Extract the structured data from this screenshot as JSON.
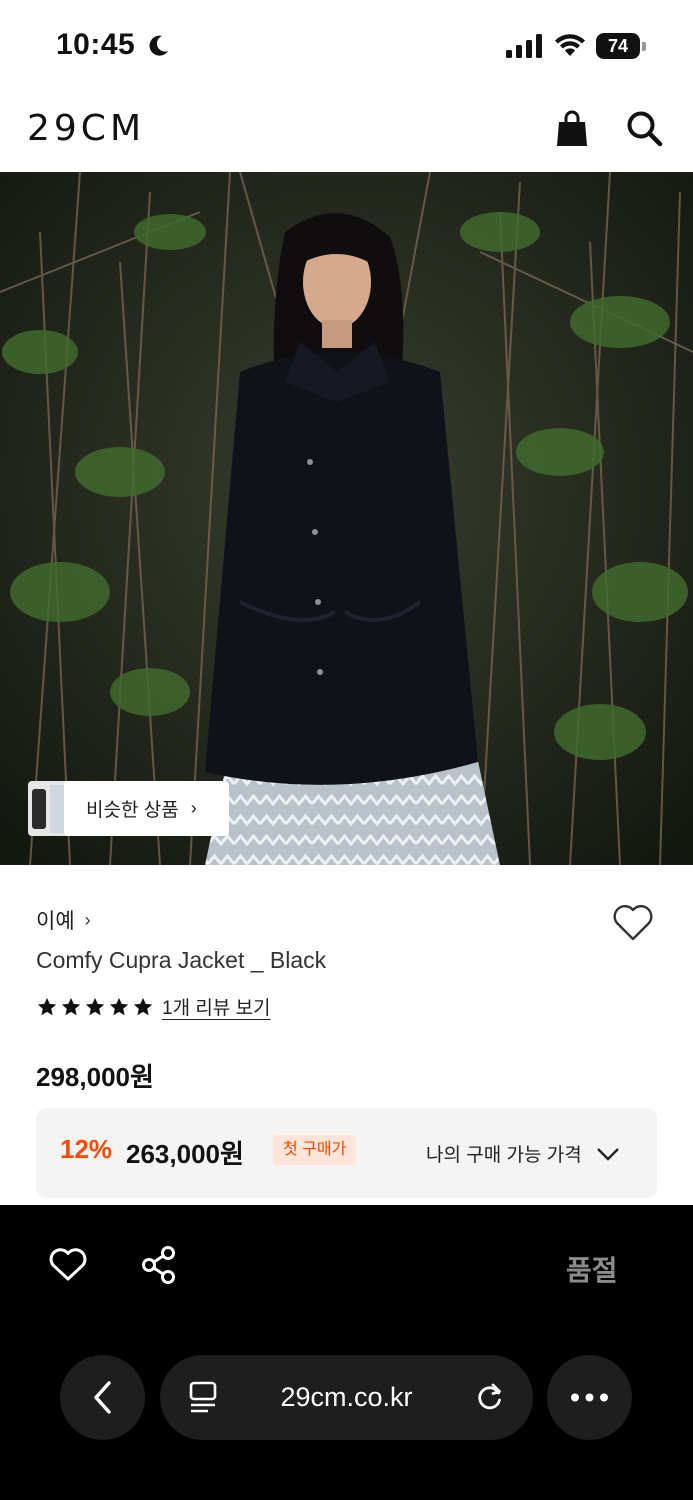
{
  "status_bar": {
    "time": "10:45",
    "battery": "74"
  },
  "header": {
    "logo": "29CM"
  },
  "hero": {
    "similar_label": "비슷한 상품"
  },
  "product": {
    "brand": "이예",
    "name": "Comfy Cupra Jacket _ Black",
    "rating_stars": 5,
    "review_link": "1개 리뷰 보기",
    "price": "298,000원",
    "discount_percent": "12%",
    "sale_price": "263,000원",
    "first_purchase_badge": "첫 구매가",
    "my_price_label": "나의 구매 가능 가격"
  },
  "action_bar": {
    "status": "품절"
  },
  "browser": {
    "url": "29cm.co.kr"
  },
  "colors": {
    "accent": "#ff4800",
    "badge_bg": "#ffe4d9",
    "bar": "#000000"
  }
}
